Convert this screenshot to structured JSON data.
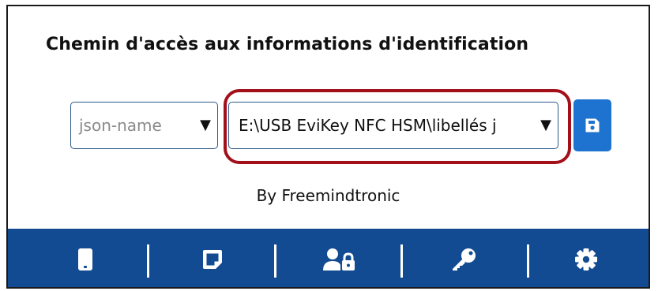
{
  "header": {
    "title": "Chemin d'accès aux informations d'identification"
  },
  "json_name_select": {
    "value": "json-name",
    "arrow": "▼"
  },
  "path_select": {
    "value": "E:\\USB EviKey NFC HSM\\libellés j",
    "arrow": "▼"
  },
  "save_button": {
    "icon": "floppy-disk-icon"
  },
  "footer": {
    "credit": "By Freemindtronic"
  },
  "bottom_nav": {
    "items": [
      {
        "icon": "phone-icon"
      },
      {
        "icon": "note-icon"
      },
      {
        "icon": "user-lock-icon"
      },
      {
        "icon": "key-icon"
      },
      {
        "icon": "gear-icon"
      }
    ]
  },
  "colors": {
    "nav_background": "#124b92",
    "save_button": "#1e73d0",
    "highlight": "#a3101a",
    "select_border": "#2c5a8c"
  }
}
